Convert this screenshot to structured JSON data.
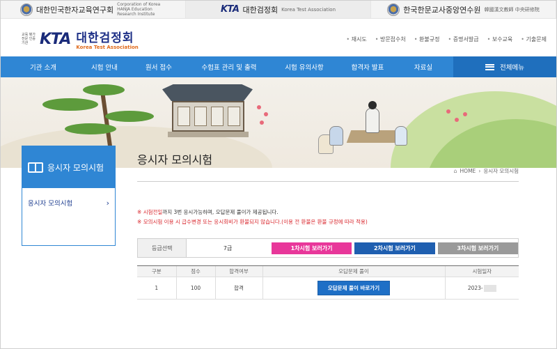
{
  "partners": [
    {
      "name": "대한민국한자교육연구회",
      "sub": "Corporation of Korea HANJA Education Research Institute"
    },
    {
      "name": "대한검정회",
      "mark": "KTA",
      "sub": "Korea Test Association"
    },
    {
      "name": "한국한문교사중앙연수원",
      "sub": "韓國漢文教師 中央研修院"
    }
  ],
  "logo": {
    "mark": "KTA",
    "tiny": "교육 평가 전문 인증기관",
    "name_ko": "대한검정회",
    "name_en": "Korea Test Association"
  },
  "util_links": [
    "재시도",
    "방문접수처",
    "환불규정",
    "증명서발급",
    "보수교육",
    "기출문제"
  ],
  "gnb": {
    "items": [
      "기관 소개",
      "시험 안내",
      "원서 접수",
      "수험표 관리 및 출력",
      "시험 유의사항",
      "합격자 발표",
      "자료실"
    ],
    "all_menu": "전체메뉴"
  },
  "side": {
    "title": "응시자 모의시험",
    "item": "응시자 모의시험"
  },
  "content": {
    "title": "응시자 모의시험",
    "breadcrumb": {
      "home": "HOME",
      "current": "응시자 모의시험"
    },
    "notice1": {
      "mark": "※",
      "red": "시험전일",
      "text": "까지 3번 응시가능하며, 오답문제 풀이가 제공됩니다."
    },
    "notice2": {
      "mark": "※",
      "text": "모의시험 이용 시 급수변경 또는 응시회비가 환불되지 않습니다.(이용 전 환불은 환불 규정에 따라 적용)"
    }
  },
  "grade_select": {
    "label": "등급선택",
    "value": "7급",
    "buttons": [
      {
        "label": "1차시험 보러가기",
        "color": "#e8379a"
      },
      {
        "label": "2차시험 보러가기",
        "color": "#1f5fb0"
      },
      {
        "label": "3차시험 보러가기",
        "color": "#9a9a9a"
      }
    ]
  },
  "results": {
    "headers": [
      "구분",
      "점수",
      "합격여부",
      "오답문제 풀이",
      "시험일자"
    ],
    "row": {
      "no": "1",
      "score": "100",
      "pass": "합격",
      "review": "오답문제 풀이 바로가기",
      "date": "2023-"
    }
  }
}
